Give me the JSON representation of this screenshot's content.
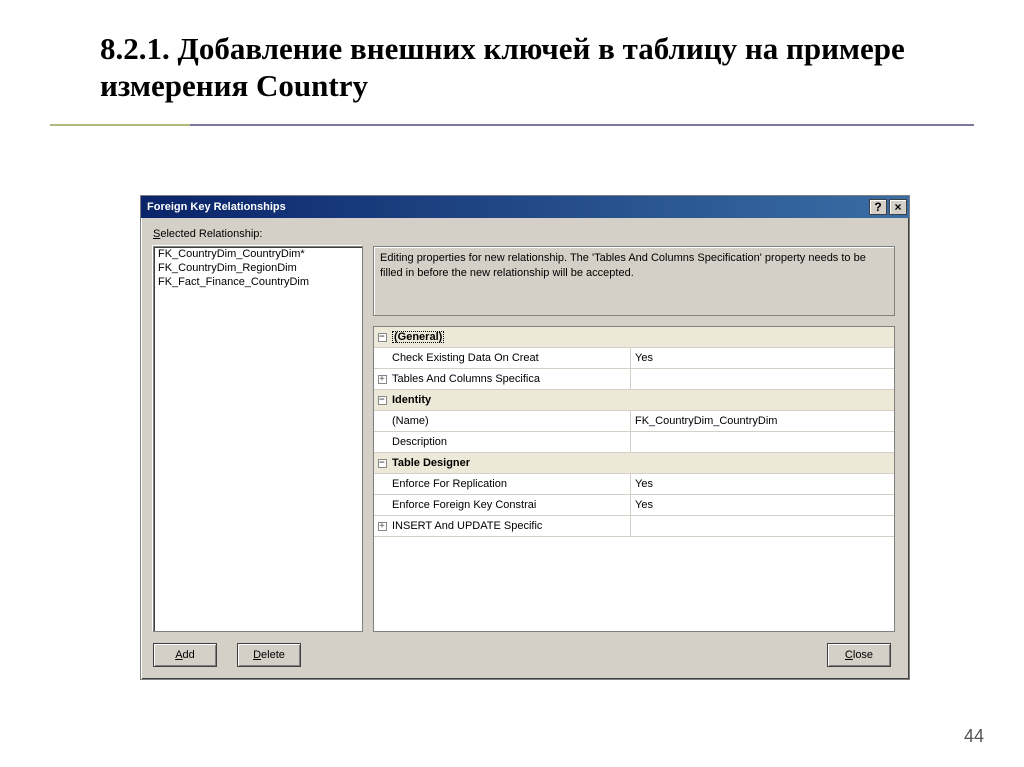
{
  "slide": {
    "title": "8.2.1. Добавление внешних ключей в таблицу на примере измерения Country",
    "page_number": "44"
  },
  "dialog": {
    "title": "Foreign Key Relationships",
    "label_selected": "Selected Relationship:",
    "help_glyph": "?",
    "close_glyph": "×",
    "relationships": [
      "FK_CountryDim_CountryDim*",
      "FK_CountryDim_RegionDim",
      "FK_Fact_Finance_CountryDim"
    ],
    "info_text": "Editing properties for new relationship.  The 'Tables And Columns Specification' property needs to be filled in before the new relationship will be accepted.",
    "buttons": {
      "add": "Add",
      "delete": "Delete",
      "close": "Close"
    },
    "grid": {
      "cat_general": "(General)",
      "row_check": {
        "label": "Check Existing Data On Creat",
        "value": "Yes"
      },
      "row_spec": {
        "label": "Tables And Columns Specifica",
        "value": ""
      },
      "cat_identity": "Identity",
      "row_name": {
        "label": "(Name)",
        "value": "FK_CountryDim_CountryDim"
      },
      "row_desc": {
        "label": "Description",
        "value": ""
      },
      "cat_td": "Table Designer",
      "row_repl": {
        "label": "Enforce For Replication",
        "value": "Yes"
      },
      "row_fkc": {
        "label": "Enforce Foreign Key Constrai",
        "value": "Yes"
      },
      "row_iu": {
        "label": "INSERT And UPDATE Specific",
        "value": ""
      }
    }
  }
}
